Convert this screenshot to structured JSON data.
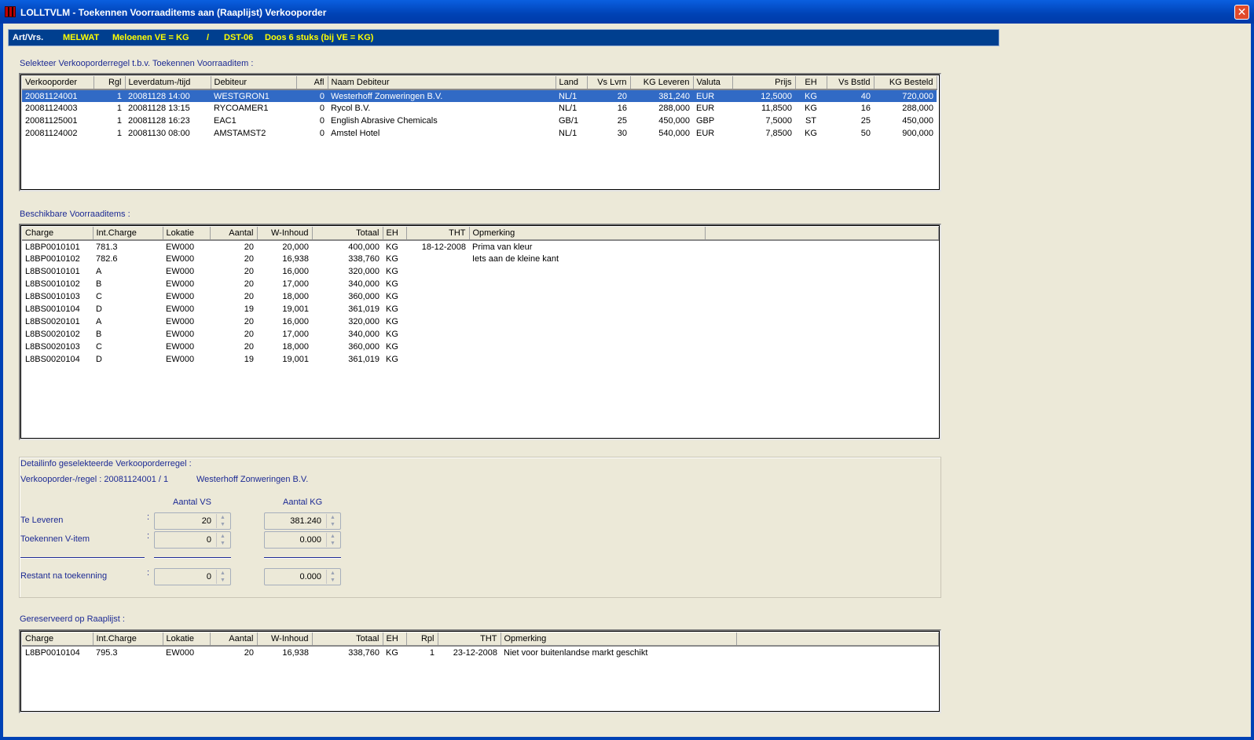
{
  "window": {
    "title": "LOLLTVLM - Toekennen Voorraaditems aan (Raaplijst) Verkooporder",
    "close_glyph": "✕"
  },
  "artbar": {
    "label": "Art/Vrs.",
    "code": "MELWAT",
    "desc": "Meloenen VE = KG",
    "sep": "/",
    "pack_code": "DST-06",
    "pack_desc": "Doos 6 stuks (bij VE  =  KG)"
  },
  "orders": {
    "label": "Selekteer Verkooporderregel t.b.v. Toekennen Voorraaditem :",
    "columns": [
      "Verkooporder",
      "Rgl",
      "Leverdatum-/tijd",
      "Debiteur",
      "Afl",
      "Naam Debiteur",
      "Land",
      "Vs Lvrn",
      "KG Leveren",
      "Valuta",
      "Prijs",
      "EH",
      "Vs Bstld",
      "KG Besteld"
    ],
    "rows": [
      [
        "20081124001",
        "1",
        "20081128 14:00",
        "WESTGRON1",
        "0",
        "Westerhoff Zonweringen B.V.",
        "NL/1",
        "20",
        "381,240",
        "EUR",
        "12,5000",
        "KG",
        "40",
        "720,000"
      ],
      [
        "20081124003",
        "1",
        "20081128 13:15",
        "RYCOAMER1",
        "0",
        "Rycol B.V.",
        "NL/1",
        "16",
        "288,000",
        "EUR",
        "11,8500",
        "KG",
        "16",
        "288,000"
      ],
      [
        "20081125001",
        "1",
        "20081128 16:23",
        "EAC1",
        "0",
        "English Abrasive Chemicals",
        "GB/1",
        "25",
        "450,000",
        "GBP",
        "7,5000",
        "ST",
        "25",
        "450,000"
      ],
      [
        "20081124002",
        "1",
        "20081130 08:00",
        "AMSTAMST2",
        "0",
        "Amstel Hotel",
        "NL/1",
        "30",
        "540,000",
        "EUR",
        "7,8500",
        "KG",
        "50",
        "900,000"
      ]
    ]
  },
  "stock": {
    "label": "Beschikbare Voorraaditems :",
    "columns": [
      "Charge",
      "Int.Charge",
      "Lokatie",
      "Aantal",
      "W-Inhoud",
      "Totaal",
      "EH",
      "THT",
      "Opmerking"
    ],
    "rows": [
      [
        "L8BP0010101",
        "781.3",
        "EW000",
        "20",
        "20,000",
        "400,000",
        "KG",
        "18-12-2008",
        "Prima van kleur"
      ],
      [
        "L8BP0010102",
        "782.6",
        "EW000",
        "20",
        "16,938",
        "338,760",
        "KG",
        "",
        "Iets aan de kleine kant"
      ],
      [
        "L8BS0010101",
        "A",
        "EW000",
        "20",
        "16,000",
        "320,000",
        "KG",
        "",
        ""
      ],
      [
        "L8BS0010102",
        "B",
        "EW000",
        "20",
        "17,000",
        "340,000",
        "KG",
        "",
        ""
      ],
      [
        "L8BS0010103",
        "C",
        "EW000",
        "20",
        "18,000",
        "360,000",
        "KG",
        "",
        ""
      ],
      [
        "L8BS0010104",
        "D",
        "EW000",
        "19",
        "19,001",
        "361,019",
        "KG",
        "",
        ""
      ],
      [
        "L8BS0020101",
        "A",
        "EW000",
        "20",
        "16,000",
        "320,000",
        "KG",
        "",
        ""
      ],
      [
        "L8BS0020102",
        "B",
        "EW000",
        "20",
        "17,000",
        "340,000",
        "KG",
        "",
        ""
      ],
      [
        "L8BS0020103",
        "C",
        "EW000",
        "20",
        "18,000",
        "360,000",
        "KG",
        "",
        ""
      ],
      [
        "L8BS0020104",
        "D",
        "EW000",
        "19",
        "19,001",
        "361,019",
        "KG",
        "",
        ""
      ]
    ]
  },
  "detail": {
    "label": "Detailinfo geselekteerde Verkooporderregel :",
    "order_line": "Verkooporder-/regel : 20081124001 / 1",
    "customer": "Westerhoff Zonweringen B.V.",
    "col_vs": "Aantal VS",
    "col_kg": "Aantal KG",
    "colon": ":",
    "rows": [
      {
        "label": "Te Leveren",
        "vs": "20",
        "kg": "381.240"
      },
      {
        "label": "Toekennen V-item",
        "vs": "0",
        "kg": "0.000"
      },
      {
        "label": "Restant na toekenning",
        "vs": "0",
        "kg": "0.000"
      }
    ]
  },
  "reserved": {
    "label": "Gereserveerd op Raaplijst :",
    "columns": [
      "Charge",
      "Int.Charge",
      "Lokatie",
      "Aantal",
      "W-Inhoud",
      "Totaal",
      "EH",
      "Rpl",
      "THT",
      "Opmerking"
    ],
    "rows": [
      [
        "L8BP0010104",
        "795.3",
        "EW000",
        "20",
        "16,938",
        "338,760",
        "KG",
        "1",
        "23-12-2008",
        "Niet voor buitenlandse markt geschikt"
      ]
    ]
  }
}
